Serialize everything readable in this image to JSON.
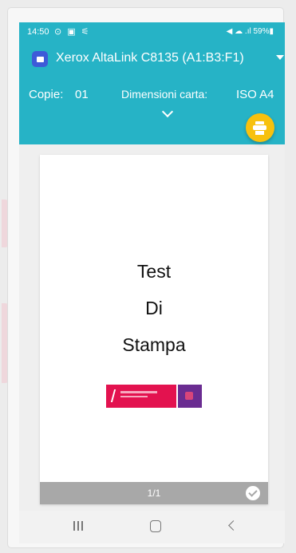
{
  "status_bar": {
    "time": "14:50",
    "left_icons": "⊙ ▣ ⚟",
    "right_text": "◀ ☁ .ıl 59%▮",
    "battery": "59%"
  },
  "header": {
    "printer_name": "Xerox AltaLink C8135 (A1:B3:F1)",
    "copies_label": "Copie:",
    "copies_value": "01",
    "paper_label": "Dimensioni carta:",
    "paper_value": "ISO A4"
  },
  "preview": {
    "line1": "Test",
    "line2": "Di",
    "line3": "Stampa",
    "page_counter": "1/1"
  },
  "icons": {
    "printer": "printer-icon",
    "fab": "print-icon",
    "expand": "chevron-down-icon",
    "check": "check-circle-icon",
    "dropdown": "caret-down-icon"
  },
  "colors": {
    "appbar": "#26b3c6",
    "fab": "#f7c10e",
    "printer_icon": "#3d5bd8",
    "logo_red": "#e3124f",
    "logo_purple": "#6a2c91"
  }
}
